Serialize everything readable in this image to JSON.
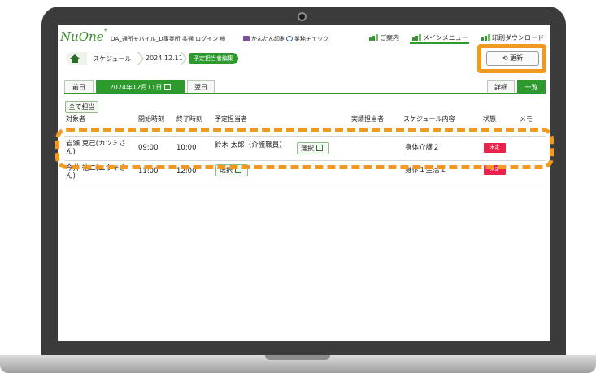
{
  "header": {
    "logo": "NuOne",
    "logo_sup": "+",
    "info": "QA_通所モバイル_D事業所 共通 ログイン 様",
    "print_link": "かんたん印刷",
    "check_link": "業務チェック",
    "menu": [
      {
        "label": "ご案内"
      },
      {
        "label": "メインメニュー"
      },
      {
        "label": "印刷ダウンロード"
      }
    ]
  },
  "breadcrumb": {
    "items": [
      "スケジュール",
      "2024.12.11"
    ],
    "current": "予定担当者編集"
  },
  "toolbar": {
    "refresh_label": "更新",
    "prev_day": "前日",
    "current_date": "2024年12月11日",
    "next_day": "翌日",
    "detail_tab": "詳細",
    "list_tab": "一覧",
    "assign_all": "全て担当"
  },
  "table": {
    "headers": {
      "subject": "対象者",
      "start": "開始時刻",
      "end": "終了時刻",
      "planned": "予定担当者",
      "actual": "実績担当者",
      "content": "スケジュール内容",
      "status": "状態",
      "memo": "メモ"
    },
    "rows": [
      {
        "subject": "岩瀬 克己(カツミさん)",
        "start": "09:00",
        "end": "10:00",
        "planned": "鈴木 太郎（介護職員）",
        "select_label": "選択",
        "content": "身体介護２",
        "status": "未定"
      },
      {
        "subject": "今井 祐二(ユウキさん)",
        "start": "11:00",
        "end": "12:00",
        "planned": "",
        "select_label": "選択",
        "content": "身体１生活１",
        "status": "未定"
      }
    ]
  },
  "colors": {
    "accent": "#2e9a2e",
    "highlight": "#f29a1f",
    "status_badge": "#e8224b"
  }
}
